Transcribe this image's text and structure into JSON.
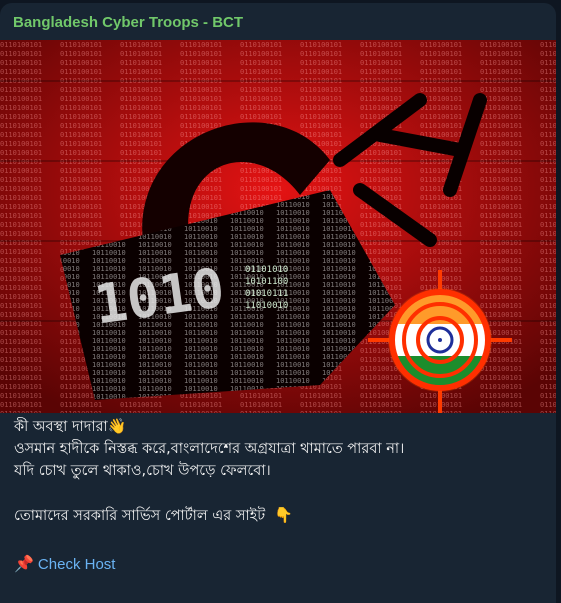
{
  "post": {
    "channel_name": "Bangladesh Cyber Troops - BCT",
    "lines": [
      "কী অবস্থা দাদারা",
      "ওসমান হাদীকে নিস্তব্ধ করে,বাংলাদেশের অগ্রযাত্রা থামাতে পারবা না।",
      "যদি চোখ তুলে থাকাও,চোখ উপড়ে ফেলবো।",
      "তোমাদের সরকারি সার্ভিস পোর্টাল এর সাইট"
    ],
    "wave_emoji": "👋",
    "point_down_emoji": "👇",
    "pin_emoji": "📌",
    "link_label": "Check Host"
  },
  "image": {
    "description_icons": [
      "padlock-icon",
      "crosshair-target-icon",
      "india-flag-icon"
    ],
    "colors": {
      "background_red": "#b30c0c",
      "binary_text": "#f7b0b0",
      "target_orange": "#ff4d00"
    }
  }
}
